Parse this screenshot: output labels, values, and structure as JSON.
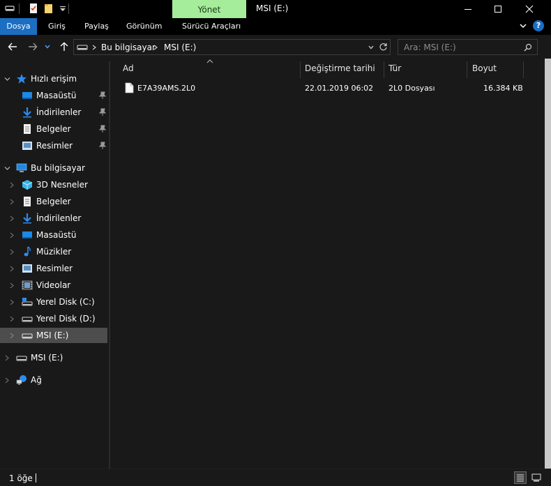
{
  "window": {
    "title": "MSI (E:)",
    "context_tab": "Yönet"
  },
  "ribbon": {
    "tabs": [
      "Dosya",
      "Giriş",
      "Paylaş",
      "Görünüm",
      "Sürücü Araçları"
    ]
  },
  "address": {
    "crumbs": [
      "Bu bilgisayar",
      "MSI (E:)"
    ],
    "search_placeholder": "Ara: MSI (E:)"
  },
  "nav": {
    "quick_access": "Hızlı erişim",
    "quick_items": [
      "Masaüstü",
      "İndirilenler",
      "Belgeler",
      "Resimler"
    ],
    "this_pc": "Bu bilgisayar",
    "pc_items": [
      "3D Nesneler",
      "Belgeler",
      "İndirilenler",
      "Masaüstü",
      "Müzikler",
      "Resimler",
      "Videolar",
      "Yerel Disk (C:)",
      "Yerel Disk (D:)",
      "MSI (E:)"
    ],
    "drive": "MSI (E:)",
    "network": "Ağ"
  },
  "columns": [
    "Ad",
    "Değiştirme tarihi",
    "Tür",
    "Boyut"
  ],
  "files": [
    {
      "name": "E7A39AMS.2L0",
      "modified": "22.01.2019 06:02",
      "type": "2L0 Dosyası",
      "size": "16.384 KB"
    }
  ],
  "status": {
    "count": "1 öğe"
  },
  "colors": {
    "accent": "#1c6ec2",
    "context_tab": "#a5ec9b",
    "background": "#191919",
    "selected": "#4d4d4d"
  }
}
